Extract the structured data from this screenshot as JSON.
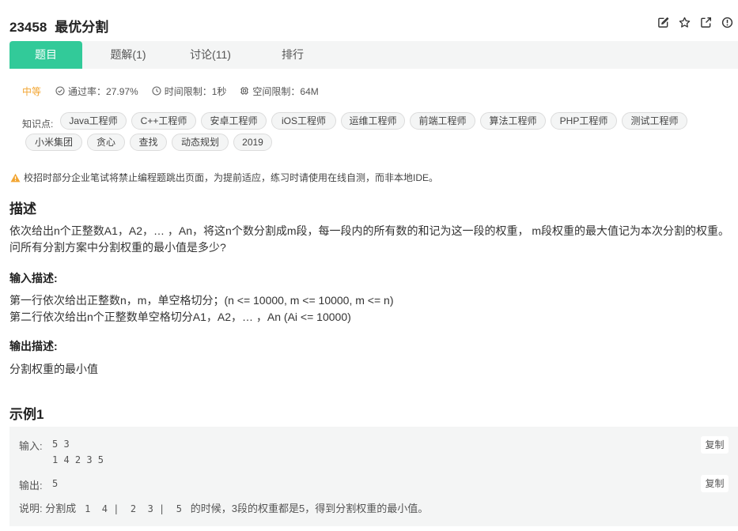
{
  "problem": {
    "id": "23458",
    "name": "最优分割"
  },
  "tabs": [
    {
      "label": "题目"
    },
    {
      "label": "题解(1)"
    },
    {
      "label": "讨论(11)"
    },
    {
      "label": "排行"
    }
  ],
  "meta": {
    "level": "中等",
    "pass_rate": "通过率：27.97%",
    "time_limit": "时间限制：1秒",
    "space_limit": "空间限制：64M"
  },
  "knowledge": {
    "label": "知识点:",
    "tags": [
      "Java工程师",
      "C++工程师",
      "安卓工程师",
      "iOS工程师",
      "运维工程师",
      "前端工程师",
      "算法工程师",
      "PHP工程师",
      "测试工程师",
      "小米集团",
      "贪心",
      "查找",
      "动态规划",
      "2019"
    ]
  },
  "notice": "校招时部分企业笔试将禁止编程题跳出页面，为提前适应，练习时请使用在线自测，而非本地IDE。",
  "description": {
    "heading": "描述",
    "text": "依次给出n个正整数A1，A2，… ，An，将这n个数分割成m段，每一段内的所有数的和记为这一段的权重， m段权重的最大值记为本次分割的权重。问所有分割方案中分割权重的最小值是多少?"
  },
  "input_desc": {
    "heading": "输入描述:",
    "line1": "第一行依次给出正整数n，m，单空格切分；(n <= 10000, m <= 10000, m <= n)",
    "line2": "第二行依次给出n个正整数单空格切分A1，A2，… ，An (Ai <= 10000)"
  },
  "output_desc": {
    "heading": "输出描述:",
    "line1": "分割权重的最小值"
  },
  "example": {
    "heading": "示例1",
    "input_label": "输入:",
    "input_line1": "5 3",
    "input_line2": "1 4 2 3 5",
    "output_label": "输出:",
    "output_value": "5",
    "copy_label": "复制",
    "explain_label": "说明:",
    "explain_pre": "分割成",
    "explain_seq": " 1  4 |  2  3 |  5 ",
    "explain_post": "的时候，3段的权重都是5，得到分割权重的最小值。"
  },
  "colors": {
    "accent": "#32ca99",
    "level_medium": "#f2a531",
    "warning": "#f2a531"
  },
  "icons": [
    "edit-icon",
    "star-icon",
    "share-icon",
    "info-icon",
    "check-circle-icon",
    "clock-icon",
    "memory-icon",
    "warning-icon"
  ]
}
